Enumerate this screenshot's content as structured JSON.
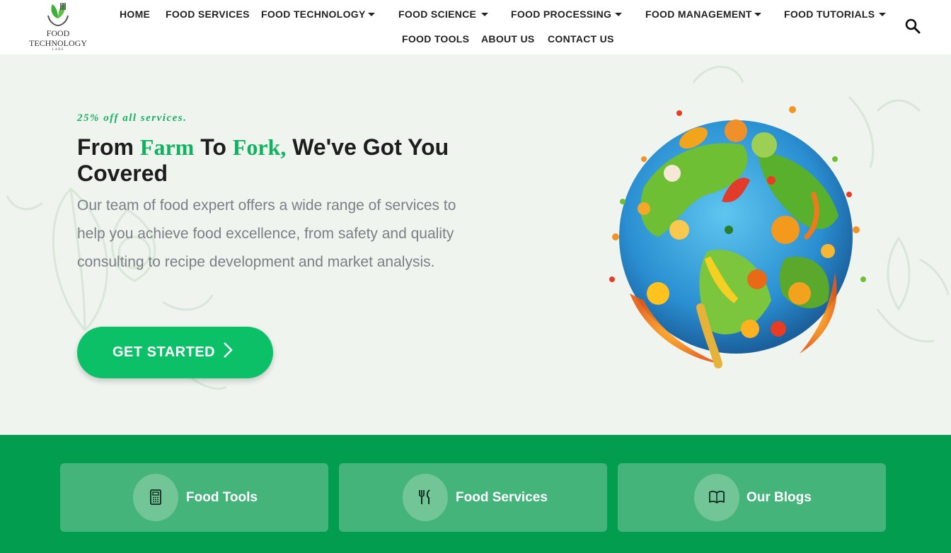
{
  "logo": {
    "line1": "FOOD",
    "line2": "TECHNOLOGY",
    "line3": "LABS"
  },
  "nav": {
    "home": "HOME",
    "food_services": "FOOD SERVICES",
    "food_technology": "FOOD TECHNOLOGY",
    "food_science": "FOOD SCIENCE",
    "food_processing": "FOOD PROCESSING",
    "food_management": "FOOD MANAGEMENT",
    "food_tutorials": "FOOD TUTORIALS",
    "food_tools": "FOOD TOOLS",
    "about_us": "ABOUT US",
    "contact_us": "CONTACT US"
  },
  "hero": {
    "promo": "25% off all services.",
    "headline_part1": "From ",
    "headline_highlight1": "Farm",
    "headline_part2": " To ",
    "headline_highlight2": "Fork,",
    "headline_part3": " We've Got You Covered",
    "description": "Our team of food expert offers a wide range of services to help you achieve food excellence, from safety and quality consulting to recipe development and market analysis.",
    "cta_label": "GET STARTED"
  },
  "cards": [
    {
      "label": "Food Tools",
      "icon": "calculator-icon"
    },
    {
      "label": "Food Services",
      "icon": "fork-knife-icon"
    },
    {
      "label": "Our Blogs",
      "icon": "book-icon"
    }
  ],
  "colors": {
    "accent": "#0bc067",
    "band": "#039d4f",
    "hero_bg": "#eff4ee",
    "card_bg": "#45b47b"
  }
}
